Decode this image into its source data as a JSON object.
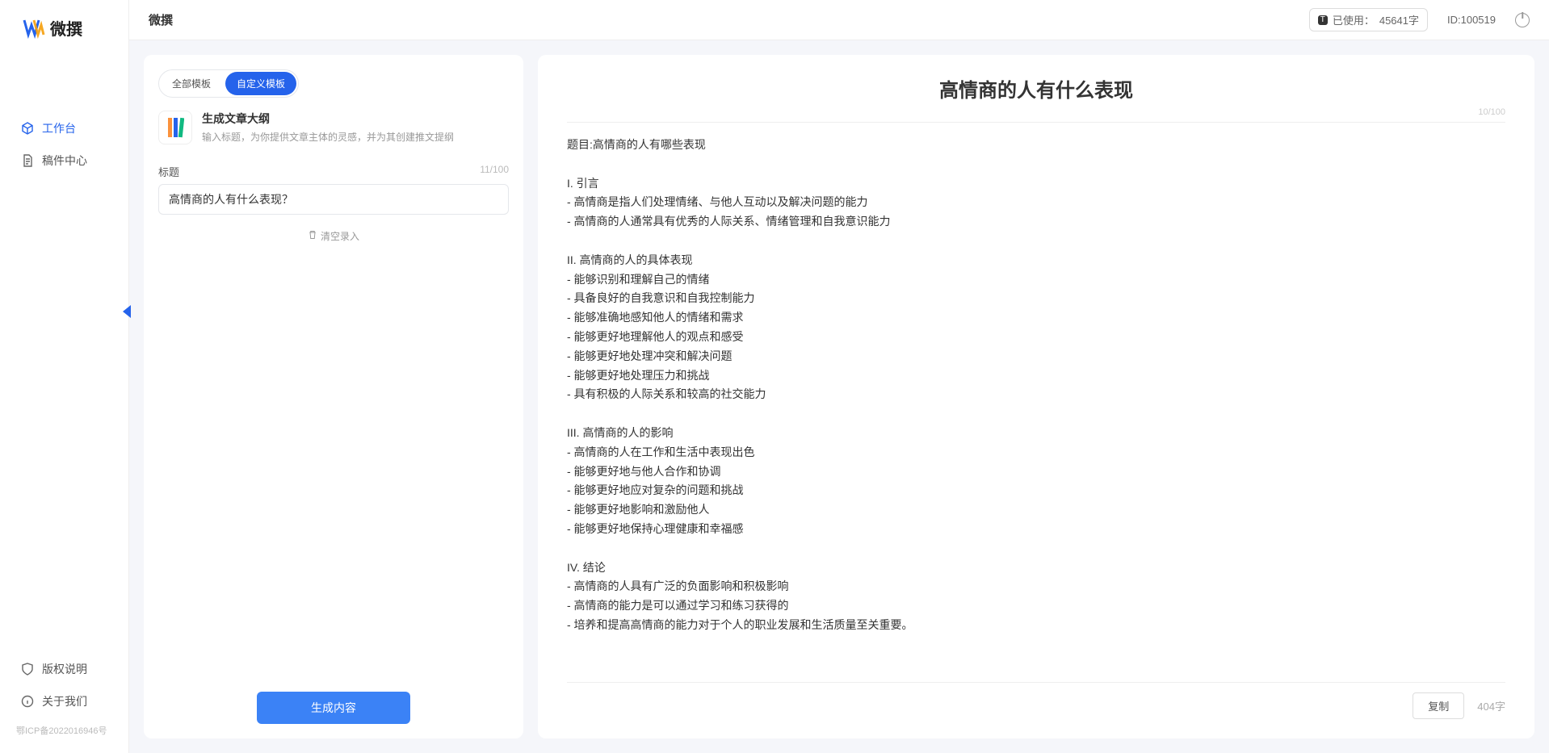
{
  "app": {
    "name": "微撰",
    "topbar_title": "微撰"
  },
  "topbar": {
    "usage_label": "已使用：",
    "usage_value": "45641字",
    "usage_badge": "T",
    "user_id_label": "ID:100519"
  },
  "sidebar": {
    "nav": [
      {
        "label": "工作台",
        "active": true,
        "icon": "cube"
      },
      {
        "label": "稿件中心",
        "active": false,
        "icon": "doc"
      }
    ],
    "bottom": [
      {
        "label": "版权说明",
        "icon": "shield"
      },
      {
        "label": "关于我们",
        "icon": "info"
      }
    ],
    "icp": "鄂ICP备2022016946号"
  },
  "left_panel": {
    "tabs": {
      "all": "全部模板",
      "custom": "自定义模板",
      "active": "custom"
    },
    "template": {
      "title": "生成文章大纲",
      "desc": "输入标题，为你提供文章主体的灵感，并为其创建推文提纲"
    },
    "field": {
      "label": "标题",
      "count": "11/100",
      "value": "高情商的人有什么表现？"
    },
    "clear_label": "清空录入",
    "generate_label": "生成内容"
  },
  "output": {
    "title": "高情商的人有什么表现",
    "count_meta": "10/100",
    "body": "题目:高情商的人有哪些表现\n\nI. 引言\n- 高情商是指人们处理情绪、与他人互动以及解决问题的能力\n- 高情商的人通常具有优秀的人际关系、情绪管理和自我意识能力\n\nII. 高情商的人的具体表现\n- 能够识别和理解自己的情绪\n- 具备良好的自我意识和自我控制能力\n- 能够准确地感知他人的情绪和需求\n- 能够更好地理解他人的观点和感受\n- 能够更好地处理冲突和解决问题\n- 能够更好地处理压力和挑战\n- 具有积极的人际关系和较高的社交能力\n\nIII. 高情商的人的影响\n- 高情商的人在工作和生活中表现出色\n- 能够更好地与他人合作和协调\n- 能够更好地应对复杂的问题和挑战\n- 能够更好地影响和激励他人\n- 能够更好地保持心理健康和幸福感\n\nIV. 结论\n- 高情商的人具有广泛的负面影响和积极影响\n- 高情商的能力是可以通过学习和练习获得的\n- 培养和提高高情商的能力对于个人的职业发展和生活质量至关重要。",
    "copy_label": "复制",
    "word_count": "404字"
  }
}
